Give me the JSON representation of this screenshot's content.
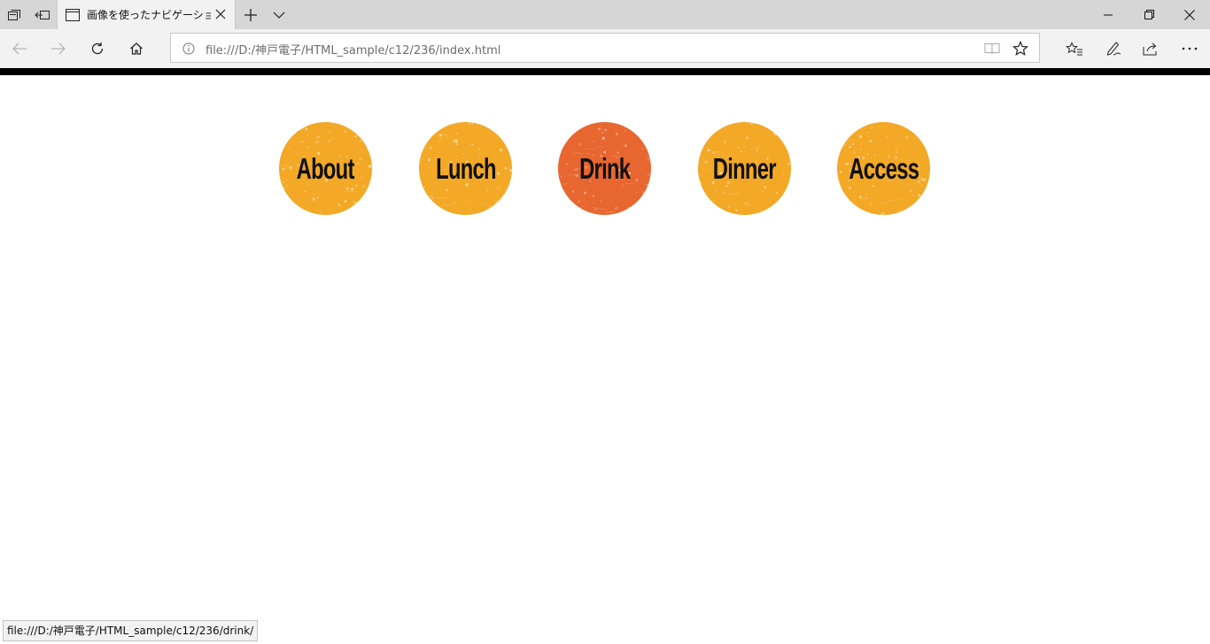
{
  "browser": {
    "tab_title": "画像を使ったナビゲーション:",
    "address": "file:///D:/神戸電子/HTML_sample/c12/236/index.html",
    "status_url": "file:///D:/神戸電子/HTML_sample/c12/236/drink/"
  },
  "nav": {
    "items": [
      {
        "label": "About",
        "color": "#f3a826",
        "active": false
      },
      {
        "label": "Lunch",
        "color": "#f3a826",
        "active": false
      },
      {
        "label": "Drink",
        "color": "#e8662f",
        "active": true
      },
      {
        "label": "Dinner",
        "color": "#f3a826",
        "active": false
      },
      {
        "label": "Access",
        "color": "#f3a826",
        "active": false
      }
    ]
  },
  "colors": {
    "topbar": "#000000",
    "chrome": "#f2f2f2",
    "tabstrip": "#d6d6d6"
  },
  "icons": [
    "tab-preview-icon",
    "set-aside-tabs-icon",
    "page-icon",
    "close-icon",
    "new-tab-icon",
    "chevron-down-icon",
    "minimize-icon",
    "restore-icon",
    "back-icon",
    "forward-icon",
    "refresh-icon",
    "home-icon",
    "info-icon",
    "reading-view-icon",
    "favorite-star-icon",
    "favorites-list-icon",
    "pen-icon",
    "share-icon",
    "more-icon"
  ]
}
